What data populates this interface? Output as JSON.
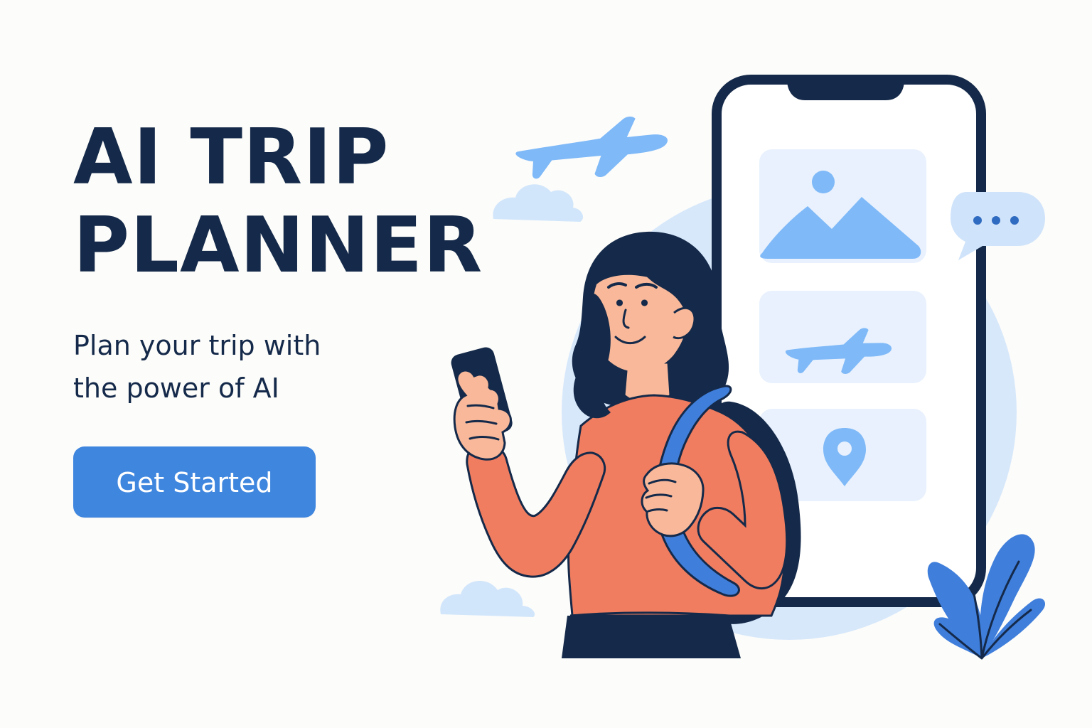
{
  "hero": {
    "title_line_1": "AI TRIP",
    "title_line_2": "PLANNER",
    "subtitle": "Plan your trip with the power of AI",
    "cta_label": "Get Started"
  },
  "colors": {
    "background": "#fcfcfa",
    "navy": "#152a4a",
    "accent_blue": "#3f86df",
    "light_blue": "#cfe3fa",
    "card_blue": "#e8f1fd",
    "icon_blue": "#7fb9f8",
    "shirt_orange": "#f07d5f",
    "skin": "#f8b899",
    "leaf_blue": "#3f7edb"
  },
  "icons": {
    "airplane": "airplane-icon",
    "image": "image-icon",
    "location": "location-pin-icon",
    "chat": "chat-bubble-icon",
    "cloud": "cloud-icon",
    "leaf": "leaf-icon"
  }
}
